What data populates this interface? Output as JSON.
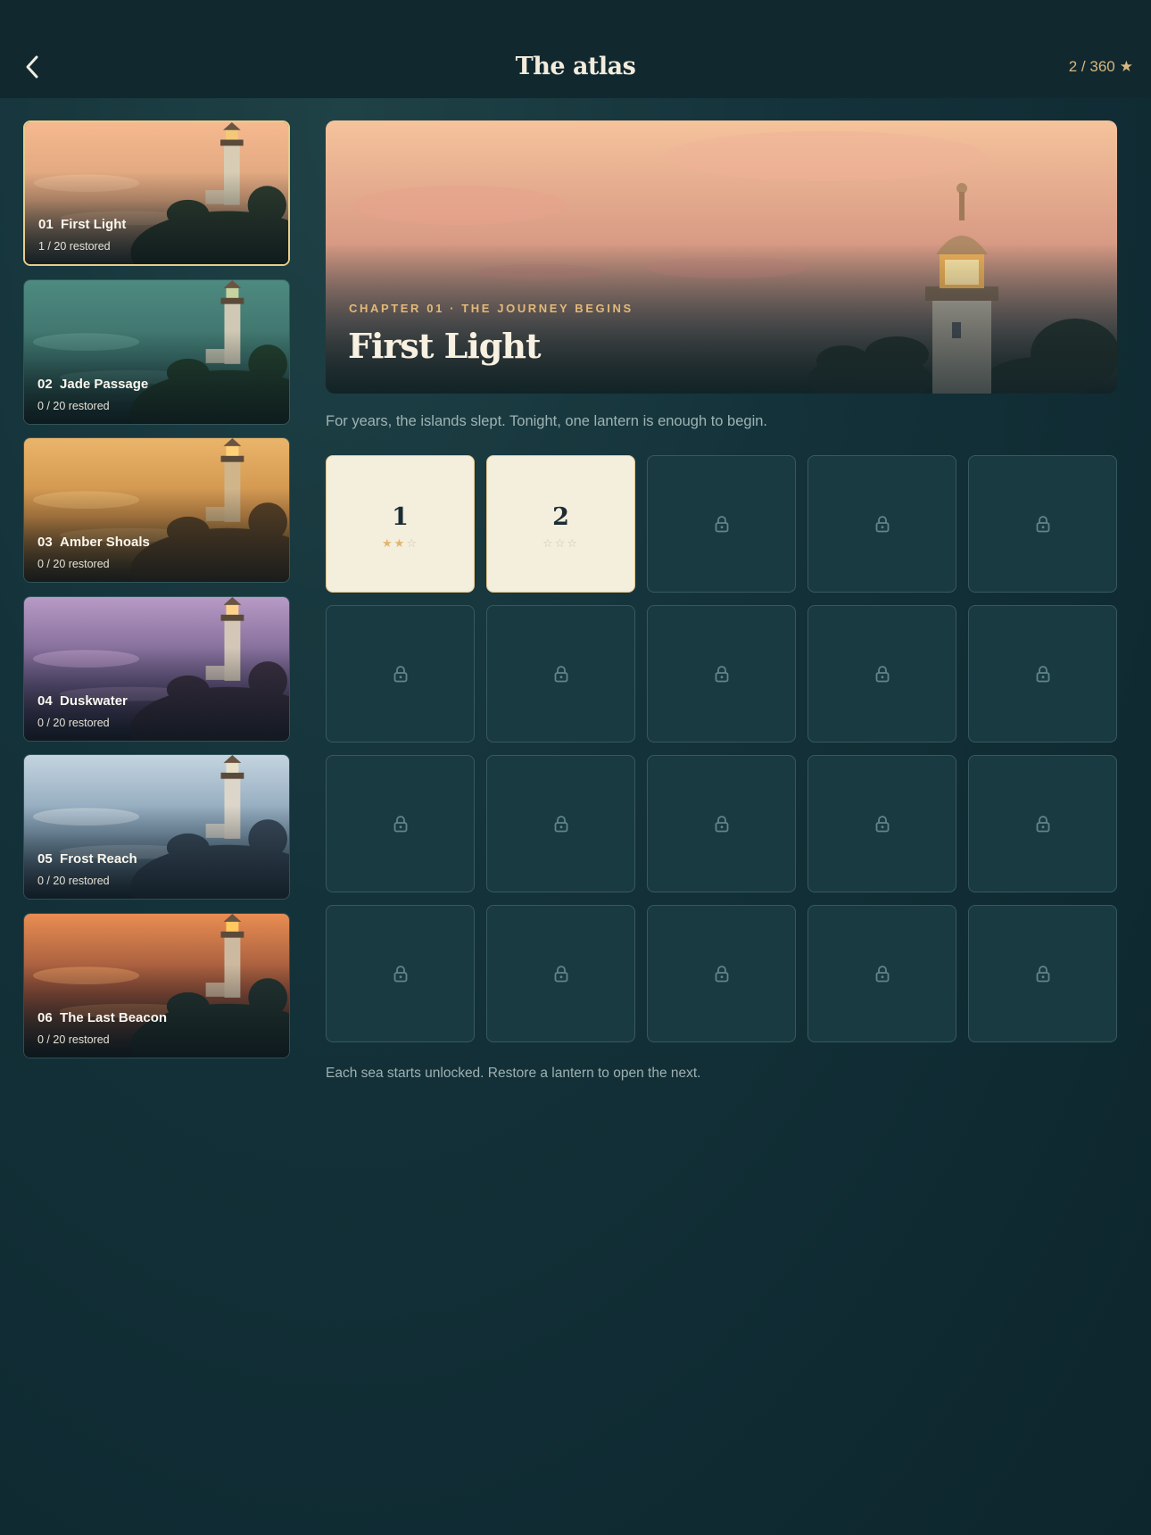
{
  "header": {
    "title": "The atlas",
    "stars": "2 / 360",
    "star_glyph": "★"
  },
  "seas": [
    {
      "number": "01",
      "name": "First Light",
      "progress": "1 / 20 restored",
      "active": true
    },
    {
      "number": "02",
      "name": "Jade Passage",
      "progress": "0 / 20 restored",
      "active": false
    },
    {
      "number": "03",
      "name": "Amber Shoals",
      "progress": "0 / 20 restored",
      "active": false
    },
    {
      "number": "04",
      "name": "Duskwater",
      "progress": "0 / 20 restored",
      "active": false
    },
    {
      "number": "05",
      "name": "Frost Reach",
      "progress": "0 / 20 restored",
      "active": false
    },
    {
      "number": "06",
      "name": "The Last Beacon",
      "progress": "0 / 20 restored",
      "active": false
    }
  ],
  "chapter": {
    "kicker": "CHAPTER 01 · THE JOURNEY BEGINS",
    "title": "First Light",
    "intro": "For years, the islands slept. Tonight, one lantern is enough to begin."
  },
  "levels": [
    {
      "number": "1",
      "unlocked": true,
      "stars_earned": 2,
      "stars_max": 3
    },
    {
      "number": "2",
      "unlocked": true,
      "stars_earned": 0,
      "stars_max": 3
    },
    {
      "unlocked": false
    },
    {
      "unlocked": false
    },
    {
      "unlocked": false
    },
    {
      "unlocked": false
    },
    {
      "unlocked": false
    },
    {
      "unlocked": false
    },
    {
      "unlocked": false
    },
    {
      "unlocked": false
    },
    {
      "unlocked": false
    },
    {
      "unlocked": false
    },
    {
      "unlocked": false
    },
    {
      "unlocked": false
    },
    {
      "unlocked": false
    },
    {
      "unlocked": false
    },
    {
      "unlocked": false
    },
    {
      "unlocked": false
    },
    {
      "unlocked": false
    },
    {
      "unlocked": false
    }
  ],
  "footer_note": "Each sea starts unlocked. Restore a lantern to open the next.",
  "colors": {
    "accent_gold": "#e3b978",
    "tile_open": "#f4eedd",
    "tile_locked": "#1a3a42",
    "background": "#12303a"
  },
  "icons": {
    "back": "chevron-left-icon",
    "lock": "lock-icon",
    "star": "star-icon"
  }
}
